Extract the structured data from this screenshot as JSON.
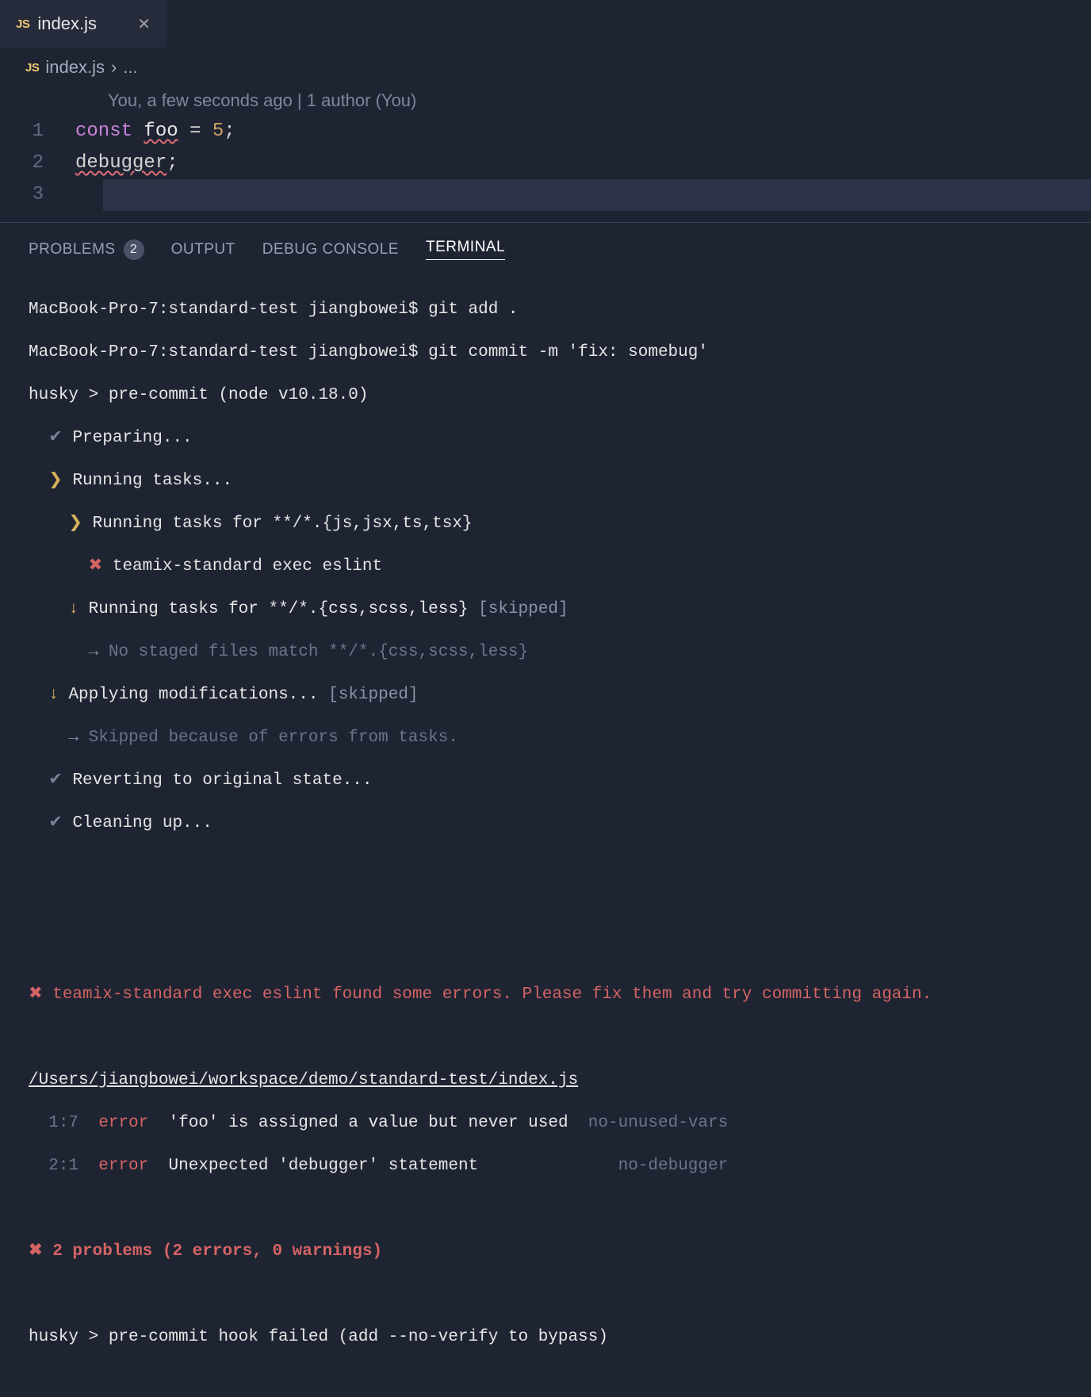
{
  "tab": {
    "icon_label": "JS",
    "filename": "index.js"
  },
  "breadcrumb": {
    "icon_label": "JS",
    "filename": "index.js",
    "rest": "..."
  },
  "blame": "You, a few seconds ago | 1 author (You)",
  "code": {
    "line1": {
      "num": "1",
      "kw": "const",
      "var": "foo",
      "op": "=",
      "val": "5",
      "semi": ";"
    },
    "line2": {
      "num": "2",
      "stmt": "debugger",
      "semi": ";"
    },
    "line3": {
      "num": "3"
    }
  },
  "panel_tabs": {
    "problems": "PROBLEMS",
    "problems_count": "2",
    "output": "OUTPUT",
    "debug": "DEBUG CONSOLE",
    "terminal": "TERMINAL"
  },
  "terminal": {
    "l1_prompt": "MacBook-Pro-7:standard-test jiangbowei$ ",
    "l1_cmd": "git add .",
    "l2_prompt": "MacBook-Pro-7:standard-test jiangbowei$ ",
    "l2_cmd": "git commit -m 'fix: somebug'",
    "l3": "husky > pre-commit (node v10.18.0)",
    "l4": "Preparing...",
    "l5": "Running tasks...",
    "l6": "Running tasks for **/*.{js,jsx,ts,tsx}",
    "l7": "teamix-standard exec eslint",
    "l8a": "Running tasks for **/*.{css,scss,less}",
    "l8b": "[skipped]",
    "l9": "No staged files match **/*.{css,scss,less}",
    "l10a": "Applying modifications...",
    "l10b": "[skipped]",
    "l11": "Skipped because of errors from tasks.",
    "l12": "Reverting to original state...",
    "l13": "Cleaning up...",
    "err_header": "teamix-standard exec eslint found some errors. Please fix them and try committing again.",
    "file_path": "/Users/jiangbowei/workspace/demo/standard-test/index.js",
    "e1_loc": "1:7",
    "e1_lvl": "error",
    "e1_msg": "'foo' is assigned a value but never used",
    "e1_rule": "no-unused-vars",
    "e2_loc": "2:1",
    "e2_lvl": "error",
    "e2_msg": "Unexpected 'debugger' statement",
    "e2_rule": "no-debugger",
    "summary": "2 problems (2 errors, 0 warnings)",
    "hook_fail": "husky > pre-commit hook failed (add --no-verify to bypass)"
  }
}
